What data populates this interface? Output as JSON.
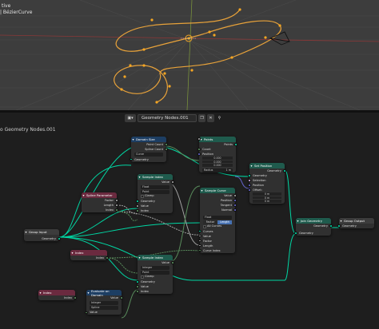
{
  "viewport": {
    "mode_label": "tive",
    "object_label": "| BézierCurve"
  },
  "editor_header": {
    "tree_name": "Geometry Nodes.001",
    "breadcrumb": "o Geometry Nodes.001"
  },
  "icons": {
    "editor_type": "node-editor-icon",
    "copy": "copy-icon",
    "close": "close-icon",
    "pin": "pin-icon"
  },
  "colors": {
    "geometry_socket": "#00d6a3",
    "curve": "#e8a23a",
    "selected_point": "#f5a623"
  },
  "nodes": {
    "domain_size": {
      "title": "Domain Size",
      "outputs": [
        "Point Count",
        "Spline Count"
      ],
      "mode": "Curve",
      "input": "Geometry"
    },
    "points": {
      "title": "Points",
      "output": "Points",
      "inputs": [
        "Count",
        "Position"
      ],
      "position_values": [
        "0.000",
        "0.000",
        "0.000"
      ],
      "radius_label": "Radius",
      "radius_value": "1 m"
    },
    "set_position": {
      "title": "Set Position",
      "output": "Geometry",
      "inputs": [
        "Geometry",
        "Selection",
        "Position"
      ],
      "offset_label": "Offset:",
      "offset_values": [
        "0 m",
        "0 m",
        "0 m"
      ]
    },
    "sample_index_1": {
      "title": "Sample Index",
      "output": "Value",
      "dtype": "Float",
      "domain": "Point",
      "clamp": "Clamp",
      "inputs": [
        "Geometry",
        "Value",
        "Index"
      ]
    },
    "spline_parameter": {
      "title": "Spline Parameter",
      "outputs": [
        "Factor",
        "Length",
        "Index"
      ]
    },
    "sample_curve": {
      "title": "Sample Curve",
      "outputs": [
        "Value",
        "Position",
        "Tangent",
        "Normal"
      ],
      "dtype": "Float",
      "mode_factor": "Factor",
      "mode_length": "Length",
      "all_curves": "All Curves",
      "inputs": [
        "Curves",
        "Value",
        "Factor",
        "Length",
        "Curve Index"
      ]
    },
    "join_geometry": {
      "title": "Join Geometry",
      "output": "Geometry",
      "input": "Geometry"
    },
    "group_output": {
      "title": "Group Output",
      "input": "Geometry"
    },
    "group_input": {
      "title": "Group Input",
      "output": "Geometry"
    },
    "index_1": {
      "title": "Index",
      "output": "Index"
    },
    "sample_index_2": {
      "title": "Sample Index",
      "output": "Value",
      "dtype": "Integer",
      "domain": "Point",
      "clamp": "Clamp",
      "inputs": [
        "Geometry",
        "Value",
        "Index"
      ]
    },
    "index_2": {
      "title": "Index",
      "output": "Index"
    },
    "evaluate_on_domain": {
      "title": "Evaluate on Domain",
      "output": "Value",
      "dtype": "Integer",
      "domain": "Spline",
      "input": "Value"
    }
  }
}
